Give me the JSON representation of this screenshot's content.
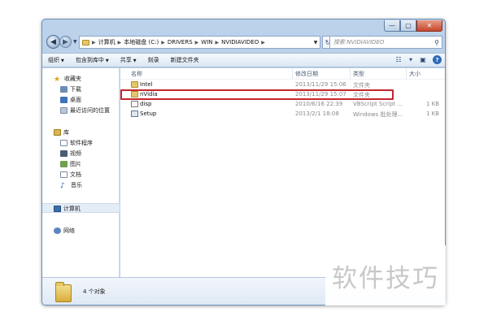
{
  "window": {
    "caption_buttons": [
      "—",
      "▢",
      "✕"
    ]
  },
  "address": {
    "crumbs": [
      "计算机",
      "本地磁盘 (C:)",
      "DRIVERS",
      "WIN",
      "NVIDIAVIDEO"
    ],
    "search_placeholder": "搜索 NVIDIAVIDEO"
  },
  "toolbar": {
    "organize": "组织",
    "include_in_library": "包含到库中",
    "share": "共享",
    "burn": "刻录",
    "new_folder": "新建文件夹"
  },
  "nav": {
    "favorites": "收藏夹",
    "favorites_items": [
      "下载",
      "桌面",
      "最近访问的位置"
    ],
    "libraries": "库",
    "libraries_items": [
      "软件程序",
      "视频",
      "图片",
      "文档",
      "音乐"
    ],
    "computer": "计算机",
    "network": "网络"
  },
  "table": {
    "columns": [
      "名称",
      "修改日期",
      "类型",
      "大小"
    ],
    "rows": [
      {
        "name": "Intel",
        "date": "2013/11/29 15:06",
        "type": "文件夹",
        "size": "",
        "icon": "folder-icon"
      },
      {
        "name": "nVidia",
        "date": "2013/11/29 15:07",
        "type": "文件夹",
        "size": "",
        "icon": "folder-icon"
      },
      {
        "name": "disp",
        "date": "2010/6/16 22:39",
        "type": "VBScript Script ...",
        "size": "1 KB",
        "icon": "script-file-icon"
      },
      {
        "name": "Setup",
        "date": "2013/2/1 18:08",
        "type": "Windows 批处理...",
        "size": "1 KB",
        "icon": "batch-file-icon"
      }
    ]
  },
  "status": {
    "count": "4 个对象"
  },
  "watermark": "软件技巧",
  "colors": {
    "highlight_box": "#c4262d",
    "folder": "#e6c66a",
    "window_frame": "#bcd2ea"
  }
}
